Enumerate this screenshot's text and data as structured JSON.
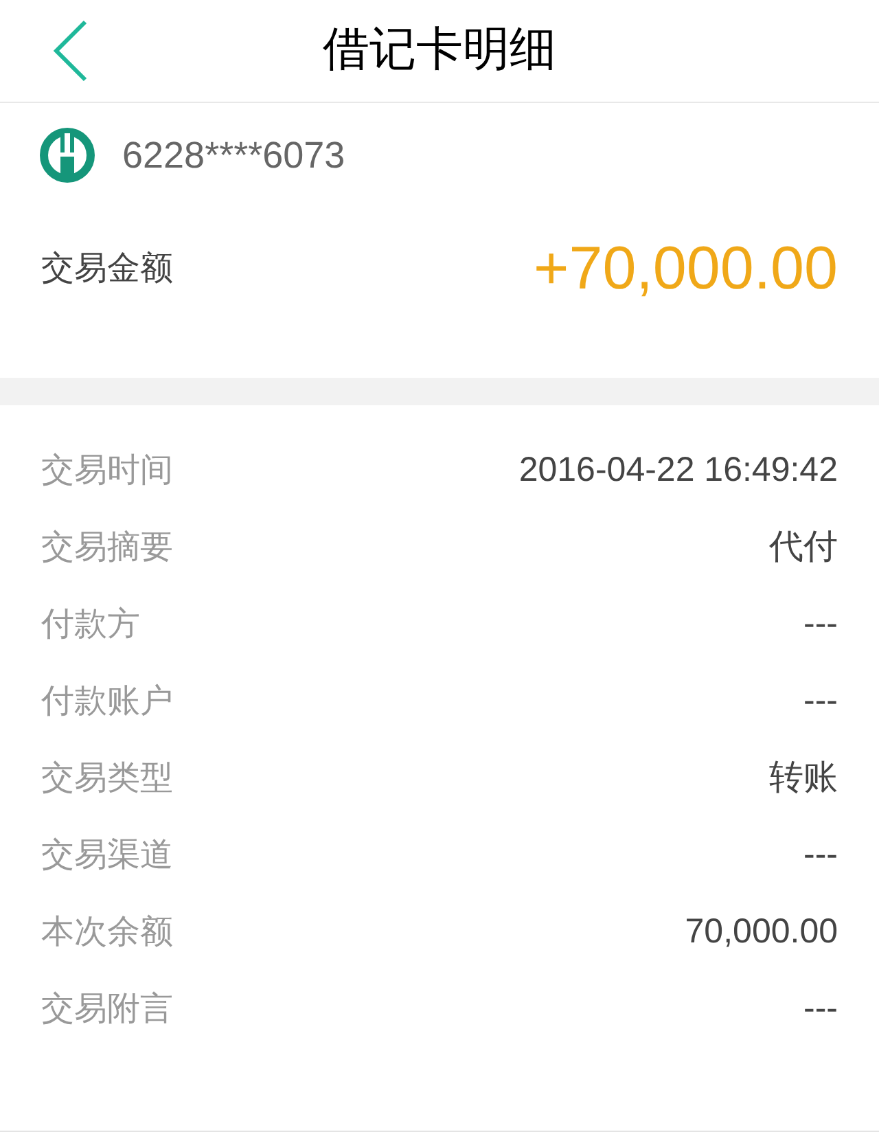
{
  "header": {
    "title": "借记卡明细"
  },
  "card": {
    "number": "6228****6073",
    "amount_label": "交易金额",
    "amount": "+70,000.00"
  },
  "details": [
    {
      "label": "交易时间",
      "value": "2016-04-22 16:49:42"
    },
    {
      "label": "交易摘要",
      "value": "代付"
    },
    {
      "label": "付款方",
      "value": "---"
    },
    {
      "label": "付款账户",
      "value": "---"
    },
    {
      "label": "交易类型",
      "value": "转账"
    },
    {
      "label": "交易渠道",
      "value": "---"
    },
    {
      "label": "本次余额",
      "value": "70,000.00"
    },
    {
      "label": "交易附言",
      "value": "---"
    }
  ]
}
